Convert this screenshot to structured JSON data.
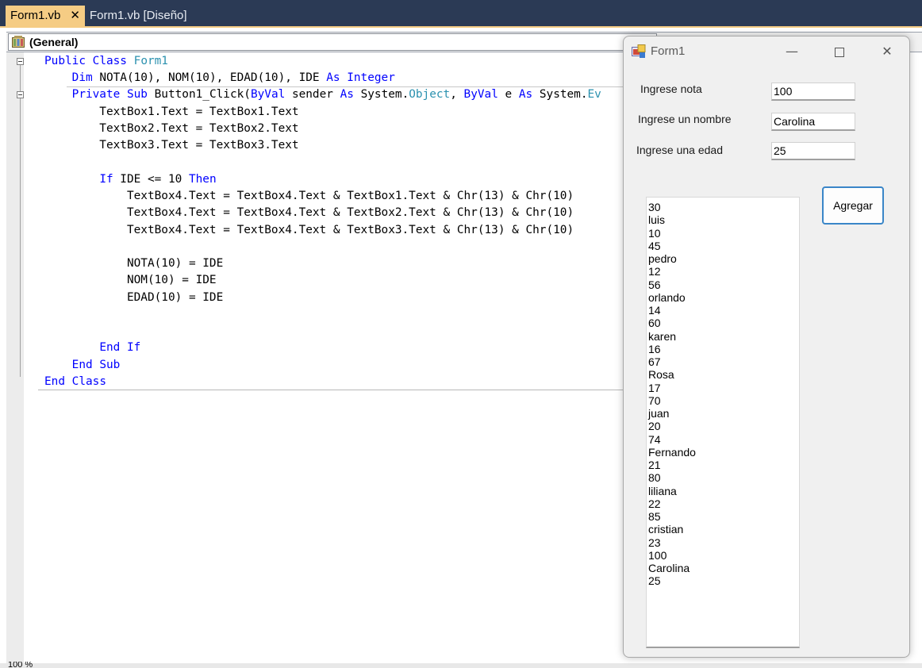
{
  "tabs": [
    {
      "label": "Form1.vb",
      "close": "✕",
      "active": true
    },
    {
      "label": "Form1.vb [Diseño]",
      "active": false
    }
  ],
  "navbar": {
    "class_combo": "(General)"
  },
  "status": {
    "zoom": "100 %"
  },
  "code_lines": [
    [
      {
        "t": "Public",
        "c": "kw"
      },
      {
        "t": " "
      },
      {
        "t": "Class",
        "c": "kw"
      },
      {
        "t": " "
      },
      {
        "t": "Form1",
        "c": "ty"
      }
    ],
    [
      {
        "t": "    "
      },
      {
        "t": "Dim",
        "c": "kw"
      },
      {
        "t": " NOTA(10), NOM(10), EDAD(10), IDE "
      },
      {
        "t": "As",
        "c": "kw"
      },
      {
        "t": " "
      },
      {
        "t": "Integer",
        "c": "kw"
      }
    ],
    [
      {
        "t": "    "
      },
      {
        "t": "Private",
        "c": "kw"
      },
      {
        "t": " "
      },
      {
        "t": "Sub",
        "c": "kw"
      },
      {
        "t": " Button1_Click("
      },
      {
        "t": "ByVal",
        "c": "kw"
      },
      {
        "t": " sender "
      },
      {
        "t": "As",
        "c": "kw"
      },
      {
        "t": " System."
      },
      {
        "t": "Object",
        "c": "ty"
      },
      {
        "t": ", "
      },
      {
        "t": "ByVal",
        "c": "kw"
      },
      {
        "t": " e "
      },
      {
        "t": "As",
        "c": "kw"
      },
      {
        "t": " System."
      },
      {
        "t": "Ev",
        "c": "ty"
      }
    ],
    [
      {
        "t": "        TextBox1.Text = TextBox1.Text"
      }
    ],
    [
      {
        "t": "        TextBox2.Text = TextBox2.Text"
      }
    ],
    [
      {
        "t": "        TextBox3.Text = TextBox3.Text"
      }
    ],
    [
      {
        "t": ""
      }
    ],
    [
      {
        "t": "        "
      },
      {
        "t": "If",
        "c": "kw"
      },
      {
        "t": " IDE <= 10 "
      },
      {
        "t": "Then",
        "c": "kw"
      }
    ],
    [
      {
        "t": "            TextBox4.Text = TextBox4.Text & TextBox1.Text & Chr(13) & Chr(10)"
      }
    ],
    [
      {
        "t": "            TextBox4.Text = TextBox4.Text & TextBox2.Text & Chr(13) & Chr(10)"
      }
    ],
    [
      {
        "t": "            TextBox4.Text = TextBox4.Text & TextBox3.Text & Chr(13) & Chr(10)"
      }
    ],
    [
      {
        "t": ""
      }
    ],
    [
      {
        "t": "            NOTA(10) = IDE"
      }
    ],
    [
      {
        "t": "            NOM(10) = IDE"
      }
    ],
    [
      {
        "t": "            EDAD(10) = IDE"
      }
    ],
    [
      {
        "t": ""
      }
    ],
    [
      {
        "t": ""
      }
    ],
    [
      {
        "t": "        "
      },
      {
        "t": "End",
        "c": "kw"
      },
      {
        "t": " "
      },
      {
        "t": "If",
        "c": "kw"
      }
    ],
    [
      {
        "t": "    "
      },
      {
        "t": "End",
        "c": "kw"
      },
      {
        "t": " "
      },
      {
        "t": "Sub",
        "c": "kw"
      }
    ],
    [
      {
        "t": "End",
        "c": "kw"
      },
      {
        "t": " "
      },
      {
        "t": "Class",
        "c": "kw"
      }
    ]
  ],
  "form": {
    "title": "Form1",
    "controls": {
      "minimize": "—",
      "close": "✕"
    },
    "label_nota": "Ingrese nota",
    "label_nombre": "Ingrese un nombre",
    "label_edad": "Ingrese una edad",
    "textbox_nota": "100",
    "textbox_nombre": "Carolina",
    "textbox_edad": "25",
    "button_agregar": "Agregar",
    "multiline_lines": [
      "30",
      "luis",
      "10",
      "45",
      "pedro",
      "12",
      "56",
      "orlando",
      "14",
      "60",
      "karen",
      "16",
      "67",
      "Rosa",
      "17",
      "70",
      "juan",
      "20",
      "74",
      "Fernando",
      "21",
      "80",
      "liliana",
      "22",
      "85",
      "cristian",
      "23",
      "100",
      "Carolina",
      "25"
    ]
  },
  "colors": {
    "keyword": "#0000ff",
    "type": "#2b91af",
    "tab_active": "#f5cc84",
    "ide_frame": "#2b3a55",
    "button_border": "#3a86c8"
  }
}
